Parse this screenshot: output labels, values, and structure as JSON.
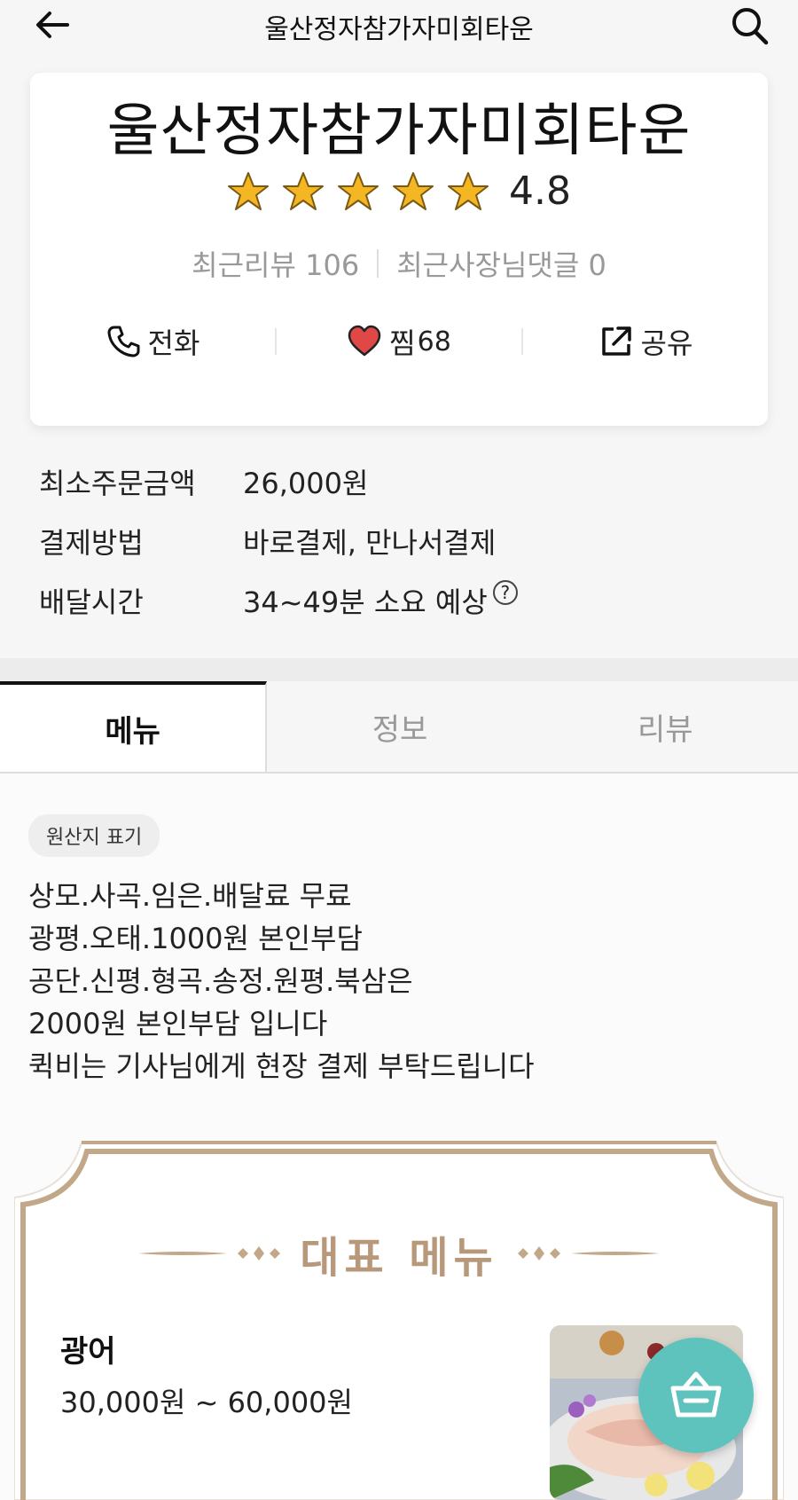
{
  "header": {
    "title": "울산정자참가자미회타운"
  },
  "store": {
    "name": "울산정자참가자미회타운",
    "rating": 4.8,
    "rating_text": "4.8",
    "stars_filled": 5,
    "recent_reviews_label": "최근리뷰 106",
    "recent_owner_replies_label": "최근사장님댓글 0",
    "actions": {
      "call_label": "전화",
      "favorite_label": "찜",
      "favorite_count": "68",
      "share_label": "공유"
    }
  },
  "info": [
    {
      "label": "최소주문금액",
      "value": "26,000원"
    },
    {
      "label": "결제방법",
      "value": "바로결제, 만나서결제"
    },
    {
      "label": "배달시간",
      "value": "34~49분 소요 예상"
    }
  ],
  "tabs": [
    {
      "label": "메뉴",
      "active": true
    },
    {
      "label": "정보",
      "active": false
    },
    {
      "label": "리뷰",
      "active": false
    }
  ],
  "notice": {
    "chip_label": "원산지 표기",
    "lines": [
      "상모.사곡.임은.배달료 무료",
      "광평.오태.1000원 본인부담",
      "공단.신평.형곡.송정.원평.북삼은",
      "2000원 본인부담 입니다",
      "퀵비는 기사님에게 현장 결제 부탁드립니다"
    ]
  },
  "featured": {
    "title": "대표 메뉴",
    "items": [
      {
        "name": "광어",
        "price": "30,000원 ~ 60,000원"
      }
    ]
  },
  "colors": {
    "accent_gold": "#b8987a",
    "cart_teal": "#5fc3bd",
    "heart_red": "#e04848",
    "star_yellow": "#f5b623"
  }
}
